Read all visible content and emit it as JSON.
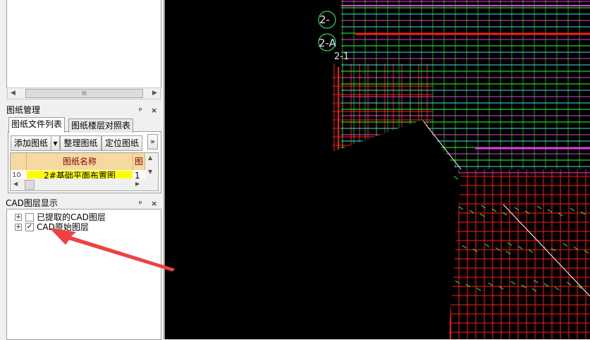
{
  "top_scroll": {
    "thumb": "III"
  },
  "drawing_panel": {
    "title": "图纸管理",
    "pin": "ᵖ",
    "close": "×",
    "tabs": [
      {
        "label": "图纸文件列表"
      },
      {
        "label": "图纸楼层对照表"
      }
    ],
    "toolbar": {
      "add_label": "添加图纸",
      "dropdown": "▾",
      "organize_label": "整理图纸",
      "locate_label": "定位图纸",
      "more": "»"
    },
    "table": {
      "headers": [
        "图纸名称",
        "图"
      ],
      "row": {
        "num": "10",
        "name": "2#基础平面布置图",
        "extra": "1"
      }
    }
  },
  "cad_layer_panel": {
    "title": "CAD图层显示",
    "pin": "ᵖ",
    "close": "×",
    "items": [
      {
        "label": "已提取的CAD图层",
        "checked": false
      },
      {
        "label": "CAD原始图层",
        "checked": true
      }
    ]
  },
  "canvas": {
    "axis_labels": [
      "2-",
      "2-A",
      "2-1"
    ]
  },
  "colors": {
    "cad_background": "#000000",
    "grid_red": "#ff1a1a",
    "wall_magenta": "#e040e0",
    "green": "#33ff33",
    "cyan": "#3fe0e0",
    "annotation_arrow": "#f04040",
    "highlight_row": "#ffff00"
  }
}
